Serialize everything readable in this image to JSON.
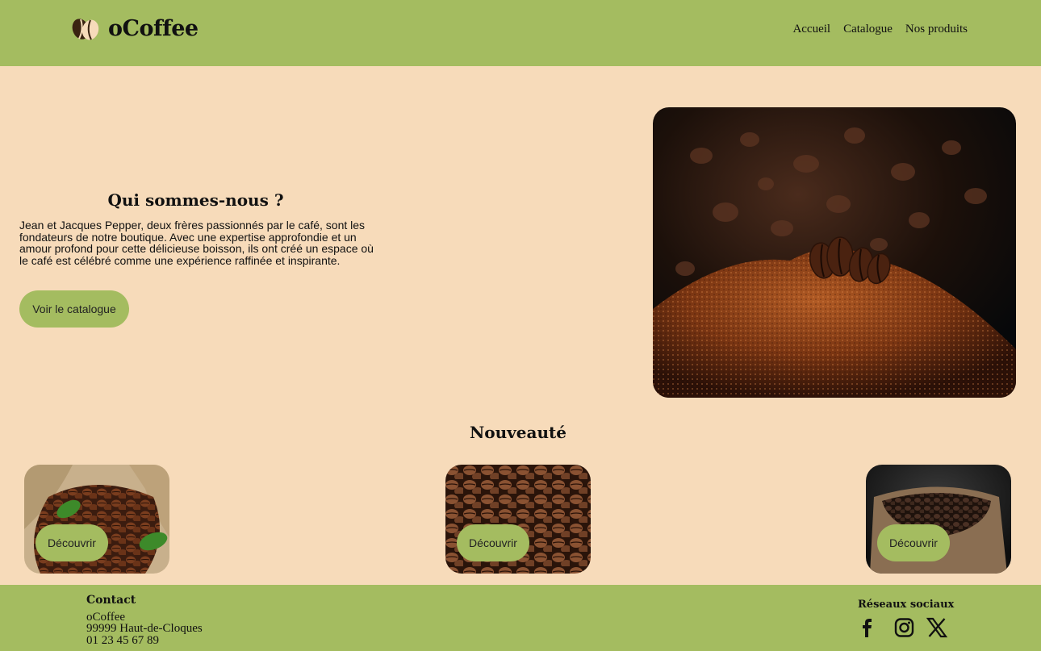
{
  "brand": {
    "name": "oCoffee"
  },
  "nav": {
    "items": [
      "Accueil",
      "Catalogue",
      "Nos produits"
    ]
  },
  "about": {
    "title": "Qui sommes-nous ?",
    "text": "Jean et Jacques Pepper, deux frères passionnés par le café, sont les fondateurs de notre boutique. Avec une expertise approfondie et un amour profond pour cette délicieuse boisson, ils ont créé un espace où le café est célébré comme une expérience raffinée et inspirante.",
    "cta_label": "Voir le catalogue"
  },
  "new_section": {
    "title": "Nouveauté",
    "cards": [
      {
        "button_label": "Découvrir"
      },
      {
        "button_label": "Découvrir"
      },
      {
        "button_label": "Découvrir"
      }
    ]
  },
  "footer": {
    "contact_title": "Contact",
    "contact_lines": [
      "oCoffee",
      "99999 Haut-de-Cloques",
      "01 23 45 67 89"
    ],
    "social_title": "Réseaux sociaux",
    "social_icons": [
      "facebook-icon",
      "instagram-icon",
      "x-icon"
    ]
  },
  "colors": {
    "accent": "#a4bc60",
    "background": "#f7dbba",
    "text": "#111111"
  }
}
